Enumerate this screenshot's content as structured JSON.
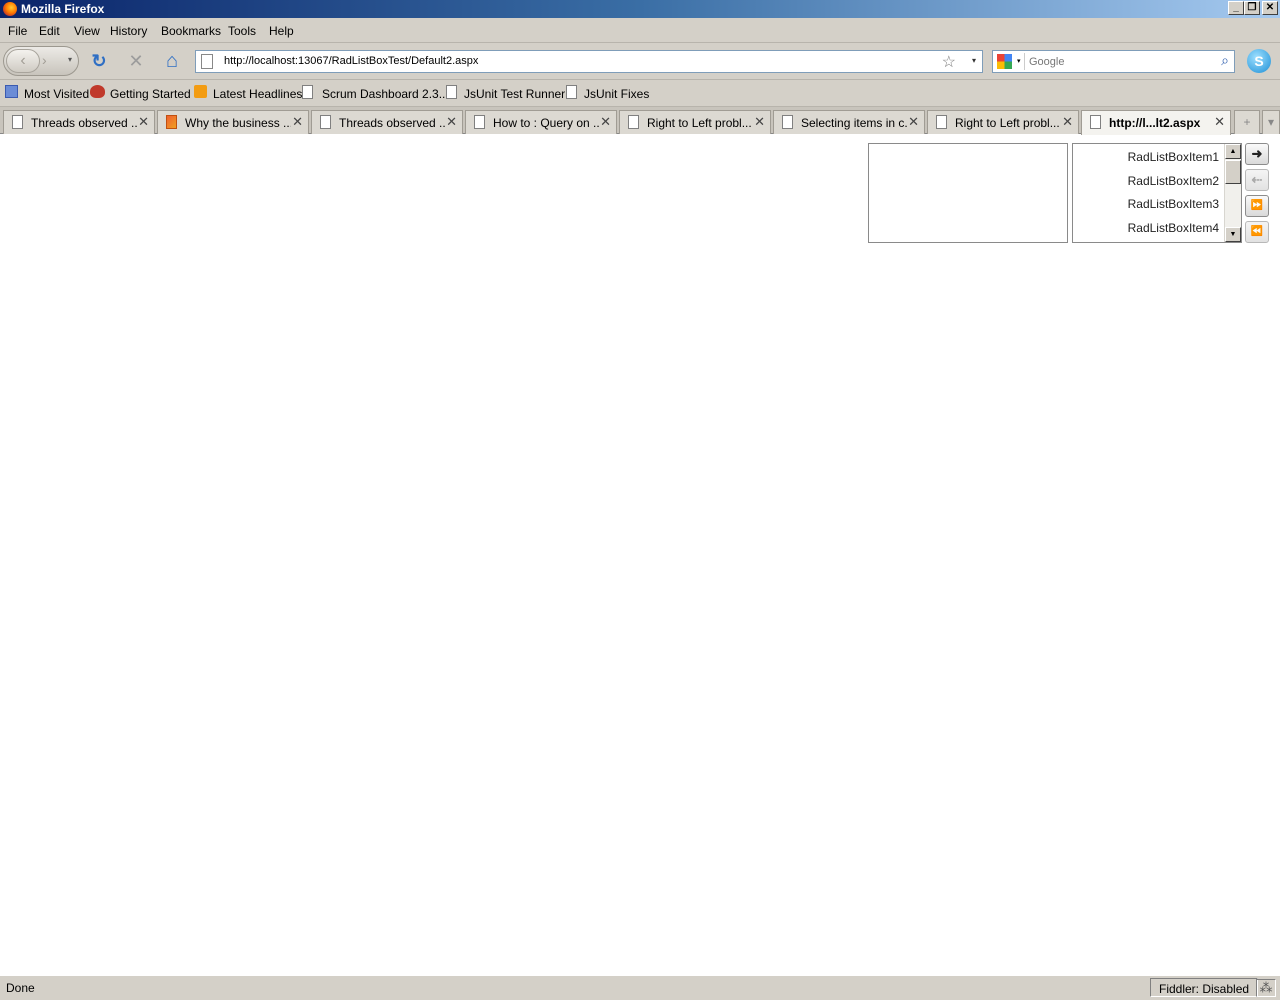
{
  "window": {
    "title": "Mozilla Firefox",
    "minimize": "_",
    "restore": "❐",
    "close": "✕"
  },
  "menu": {
    "items": [
      "File",
      "Edit",
      "View",
      "History",
      "Bookmarks",
      "Tools",
      "Help"
    ]
  },
  "nav": {
    "back_glyph": "‹",
    "forward_glyph": "›",
    "dropdown_glyph": "▾",
    "reload_glyph": "↻",
    "stop_glyph": "✕",
    "home_glyph": "⌂",
    "url": "http://localhost:13067/RadListBoxTest/Default2.aspx",
    "star_glyph": "☆",
    "search_placeholder": "Google",
    "search_glyph": "⌕",
    "skype_glyph": "S"
  },
  "bookmarks": {
    "items": [
      "Most Visited",
      "Getting Started",
      "Latest Headlines",
      "Scrum Dashboard 2.3...",
      "JsUnit Test Runner",
      "JsUnit Fixes"
    ]
  },
  "tabs": {
    "items": [
      "Threads observed ...",
      "Why the business ...",
      "Threads observed ...",
      "How to : Query on ...",
      "Right to Left probl...",
      "Selecting items in c...",
      "Right to Left probl...",
      "http://l...lt2.aspx"
    ],
    "close_glyph": "✕",
    "new_tab_glyph": "+",
    "list_glyph": "▾"
  },
  "listbox": {
    "right_items": [
      "RadListBoxItem1",
      "RadListBoxItem2",
      "RadListBoxItem3",
      "RadListBoxItem4"
    ],
    "scroll_up": "▲",
    "scroll_down": "▼",
    "buttons": {
      "transfer_to": "➜",
      "transfer_from": "⇠",
      "transfer_all_to": "⏩",
      "transfer_all_from": "⏪"
    }
  },
  "status": {
    "text": "Done",
    "fiddler": "Fiddler: Disabled",
    "grip": "⁂"
  }
}
